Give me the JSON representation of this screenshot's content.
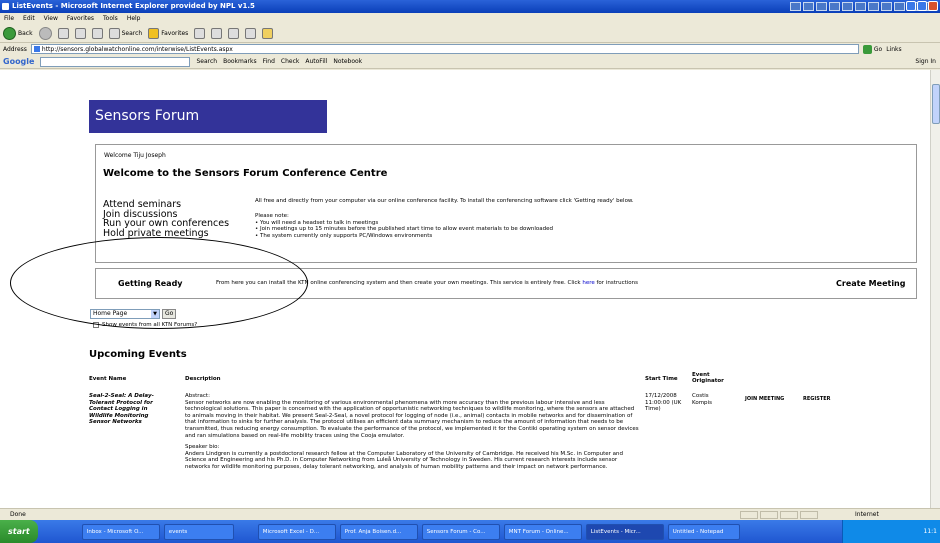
{
  "window": {
    "title": "ListEvents - Microsoft Internet Explorer provided by NPL v1.5"
  },
  "menu": [
    "File",
    "Edit",
    "View",
    "Favorites",
    "Tools",
    "Help"
  ],
  "toolbar": {
    "back": "Back",
    "search": "Search",
    "favorites": "Favorites"
  },
  "address": {
    "label": "Address",
    "url": "http://sensors.globalwatchonline.com/interwise/ListEvents.aspx",
    "go": "Go",
    "links": "Links"
  },
  "googlebar": {
    "logo": "Google",
    "search": "Search",
    "bookmarks": "Bookmarks",
    "find": "Find",
    "check": "Check",
    "autofill": "AutoFill",
    "notebook": "Notebook",
    "signin": "Sign In"
  },
  "page": {
    "banner": "Sensors Forum",
    "welcome_user": "Welcome Tiju Joseph",
    "welcome_title": "Welcome to the Sensors Forum Conference Centre",
    "bullets": [
      "Attend seminars",
      "Join discussions",
      "Run your own conferences",
      "Hold private meetings"
    ],
    "intro": "All free and directly from your computer via our online conference facility. To install the conferencing software click 'Getting ready' below.",
    "please_note": "Please note:",
    "notes": [
      "You will need a headset to talk in meetings",
      "Join meetings up to 15 minutes before the published start time to allow event materials to be downloaded",
      "The system currently only supports PC/Windows environments"
    ],
    "getting_ready": "Getting Ready",
    "ready_text_before": "From here you can install the KTN online conferencing system and then create your own meetings. This service is entirely free. Click",
    "ready_link": "here",
    "ready_text_after": "for instructions",
    "create_meeting": "Create Meeting",
    "select_value": "Home Page",
    "go_button": "Go",
    "show_all": "Show events from all KTN Forums?",
    "upcoming": "Upcoming Events",
    "headers": {
      "name": "Event Name",
      "description": "Description",
      "start": "Start Time",
      "originator": "Event Originator"
    },
    "event": {
      "name": "Seal-2-Seal: A Delay-Tolerant Protocol for Contact Logging in Wildlife Monitoring Sensor Networks",
      "abstract_label": "Abstract:",
      "abstract": "Sensor networks are now enabling the monitoring of various environmental phenomena with more accuracy than the previous labour intensive and less technological solutions. This paper is concerned with the application of opportunistic networking techniques to wildlife monitoring, where the sensors are attached to animals moving in their habitat. We present Seal-2-Seal, a novel protocol for logging of node (i.e., animal) contacts in mobile networks and for dissemination of that information to sinks for further analysis. The protocol utilises an efficient data summary mechanism to reduce the amount of information that needs to be transmitted, thus reducing energy consumption. To evaluate the performance of the protocol, we implemented it for the Contiki operating system on sensor devices and ran simulations based on real-life mobility traces using the Cooja emulator.",
      "bio_label": "Speaker bio:",
      "bio": "Anders Lindgren is currently a postdoctoral research fellow at the Computer Laboratory of the University of Cambridge. He received his M.Sc. in Computer and Science and Engineering and his Ph.D. in Computer Networking from Luleå University of Technology in Sweden. His current research interests include sensor networks for wildlife monitoring purposes, delay tolerant networking, and analysis of human mobility patterns and their impact on network performance.",
      "start": "17/12/2008 11:00:00 (UK Time)",
      "originator": "Costis Kompis",
      "join": "JOIN MEETING",
      "register": "REGISTER"
    }
  },
  "status": {
    "text": "Done",
    "zone": "Internet"
  },
  "taskbar": {
    "start": "start",
    "tasks": [
      "Inbox - Microsoft O...",
      "events",
      "Microsoft Excel - D...",
      "Prof. Anja Boisen.d...",
      "Sensors Forum - Co...",
      "MNT Forum - Online...",
      "ListEvents - Micr...",
      "Untitled - Notepad"
    ],
    "clock": "11:1"
  }
}
